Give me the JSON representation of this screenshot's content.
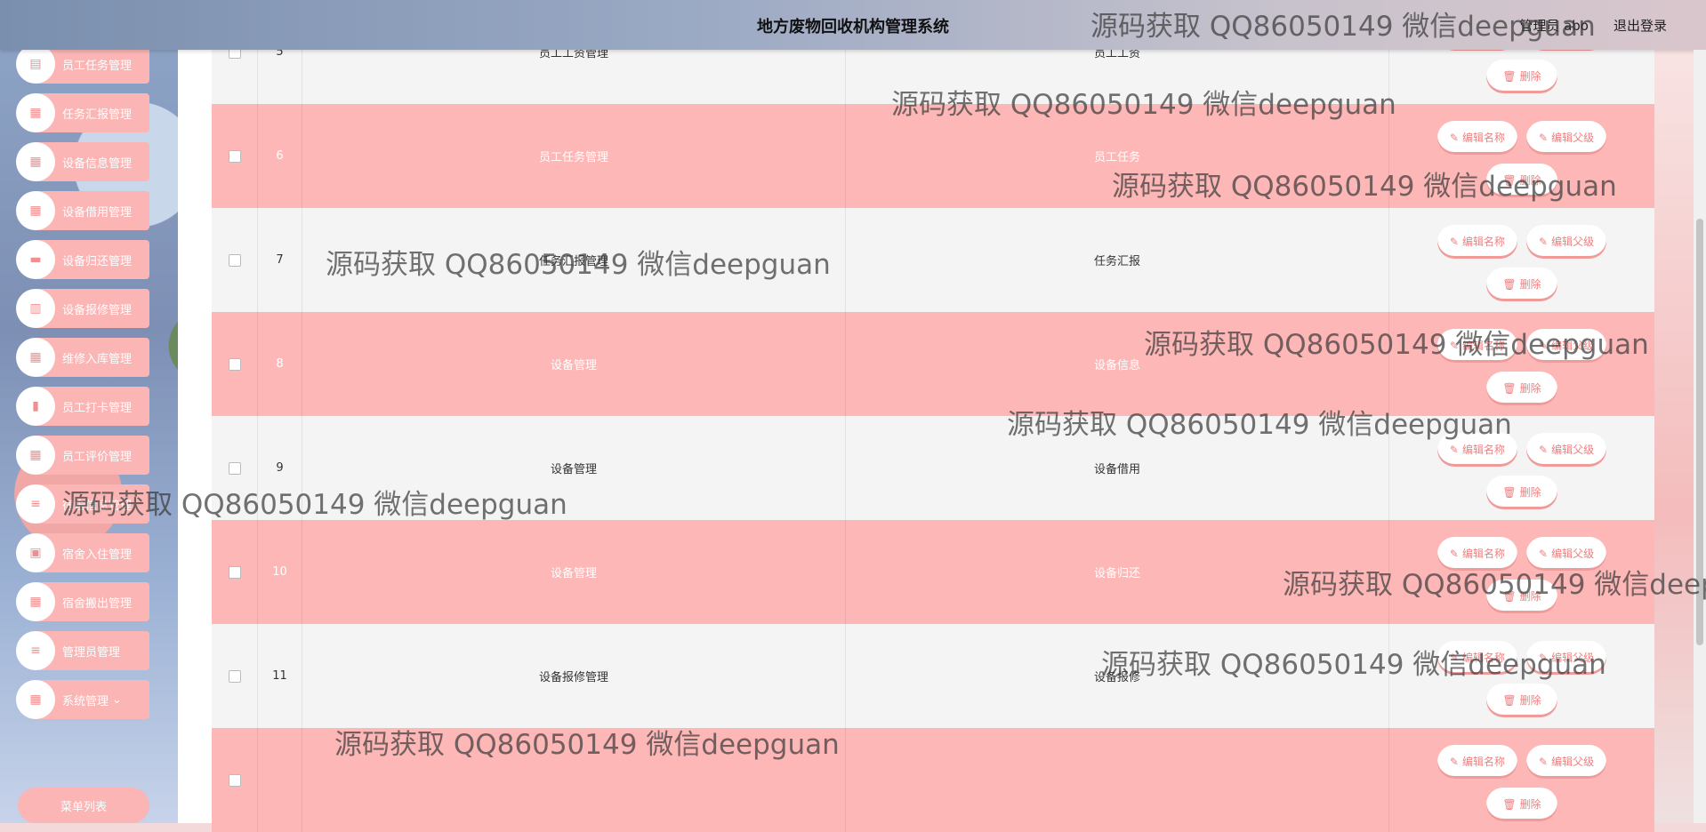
{
  "header": {
    "title": "地方废物回收机构管理系统",
    "user": "管理员 abo",
    "logout": "退出登录"
  },
  "sidebar": {
    "items": [
      {
        "label": "员工任务管理",
        "icon": "clipboard-icon"
      },
      {
        "label": "任务汇报管理",
        "icon": "grid-icon"
      },
      {
        "label": "设备信息管理",
        "icon": "grid-icon"
      },
      {
        "label": "设备借用管理",
        "icon": "grid-icon"
      },
      {
        "label": "设备归还管理",
        "icon": "chat-icon"
      },
      {
        "label": "设备报修管理",
        "icon": "chart-icon"
      },
      {
        "label": "维修入库管理",
        "icon": "grid-icon"
      },
      {
        "label": "员工打卡管理",
        "icon": "bar-chart-icon"
      },
      {
        "label": "员工评价管理",
        "icon": "grid-icon"
      },
      {
        "label": "宿舍信息管理",
        "icon": "list-icon"
      },
      {
        "label": "宿舍入住管理",
        "icon": "print-icon"
      },
      {
        "label": "宿舍搬出管理",
        "icon": "grid-icon"
      },
      {
        "label": "管理员管理",
        "icon": "list-icon"
      },
      {
        "label": "系统管理",
        "icon": "grid-icon"
      }
    ],
    "sub_item": "菜单列表"
  },
  "table": {
    "rows": [
      {
        "num": "5",
        "name": "员工工资管理",
        "parent": "员工工资"
      },
      {
        "num": "6",
        "name": "员工任务管理",
        "parent": "员工任务"
      },
      {
        "num": "7",
        "name": "任务汇报管理",
        "parent": "任务汇报"
      },
      {
        "num": "8",
        "name": "设备管理",
        "parent": "设备信息"
      },
      {
        "num": "9",
        "name": "设备管理",
        "parent": "设备借用"
      },
      {
        "num": "10",
        "name": "设备管理",
        "parent": "设备归还"
      },
      {
        "num": "11",
        "name": "设备报修管理",
        "parent": "设备报修"
      },
      {
        "num": "",
        "name": "",
        "parent": ""
      }
    ],
    "edit_name_label": "编辑名称",
    "edit_parent_label": "编辑父级",
    "delete_label": "删除"
  },
  "watermark": "源码获取 QQ86050149 微信deepguan"
}
